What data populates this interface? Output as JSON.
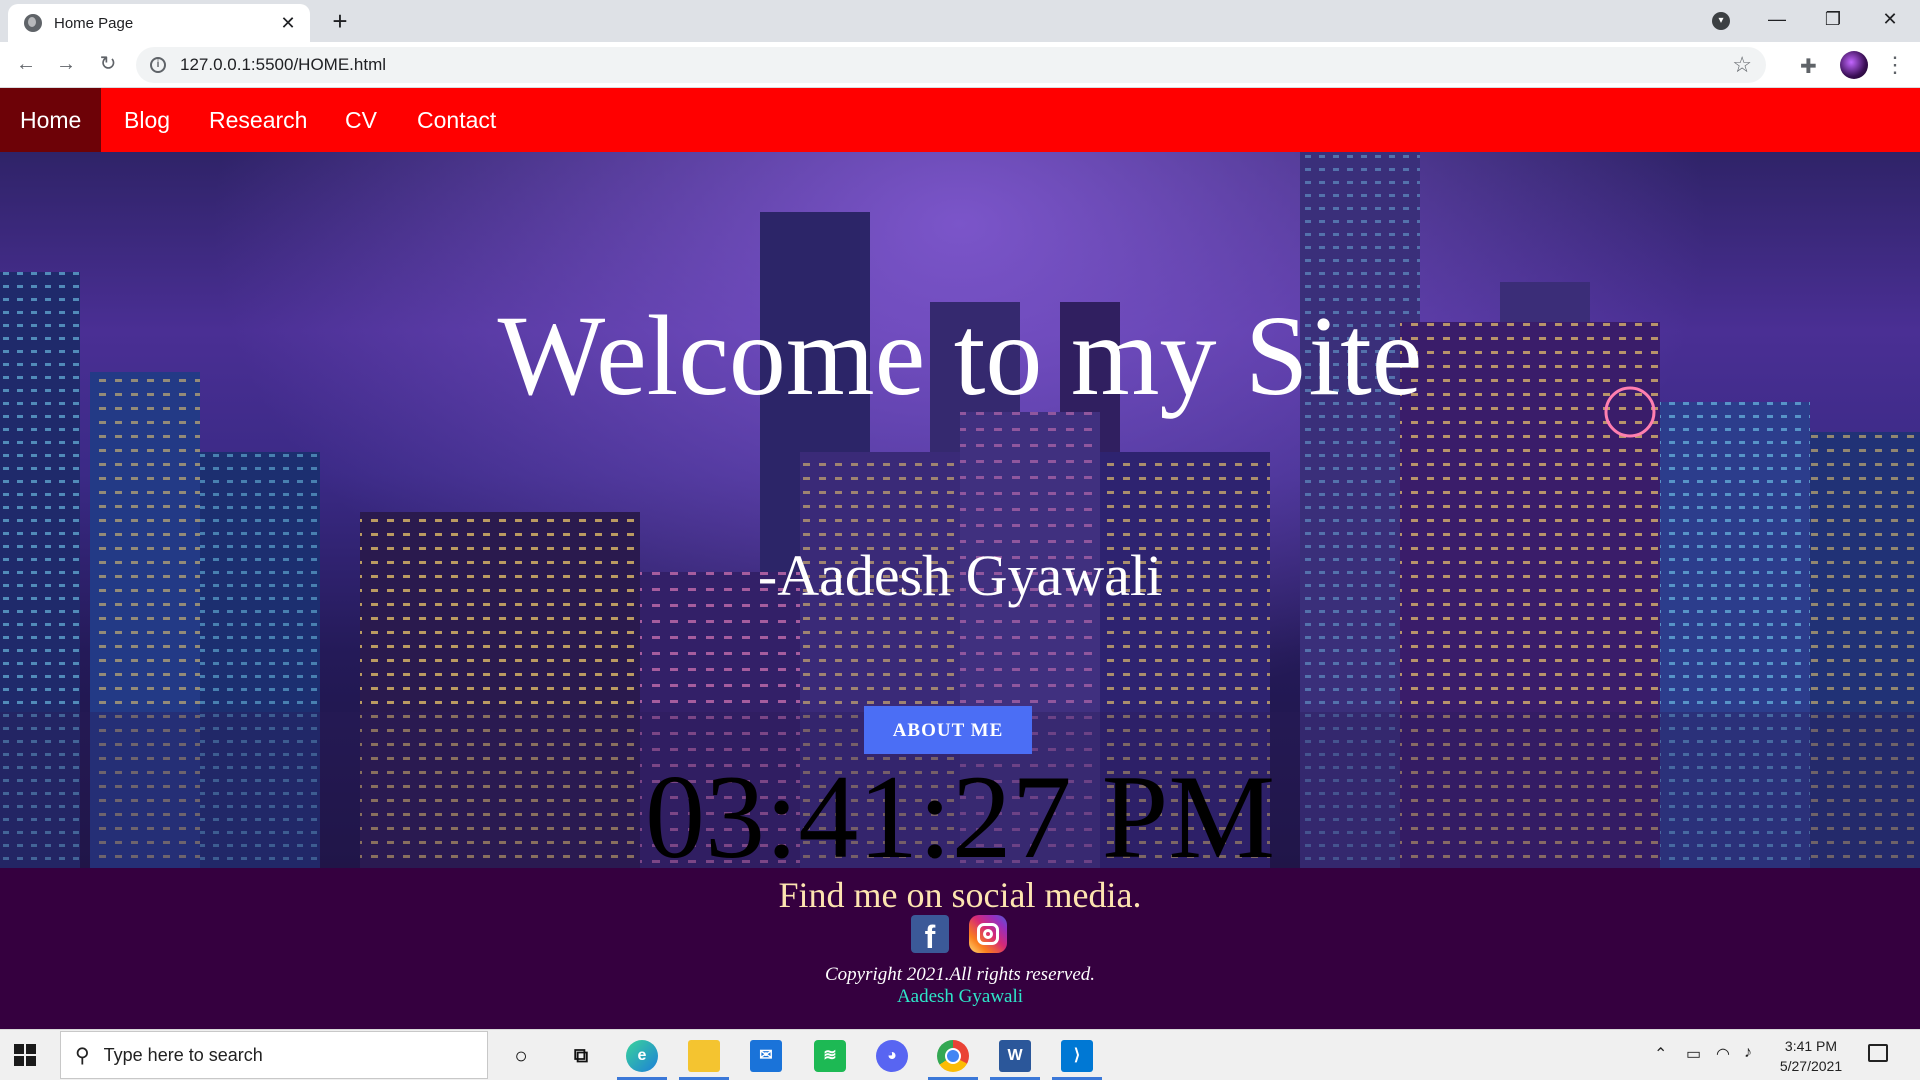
{
  "browser": {
    "tab_title": "Home Page",
    "tab_close": "✕",
    "new_tab": "+",
    "url": "127.0.0.1:5500/HOME.html",
    "minimize": "—",
    "maximize": "❐",
    "close": "✕"
  },
  "site": {
    "nav": [
      {
        "label": "Home",
        "active": true
      },
      {
        "label": "Blog"
      },
      {
        "label": "Research"
      },
      {
        "label": "CV"
      },
      {
        "label": "Contact"
      }
    ],
    "hero": {
      "title": "Welcome to my Site",
      "author": "-Aadesh Gyawali",
      "about_button": "ABOUT ME",
      "clock": "03:41:27 PM"
    },
    "footer": {
      "tagline": "Find me on social media.",
      "social": [
        {
          "name": "facebook-icon",
          "glyph": "f"
        },
        {
          "name": "instagram-icon"
        }
      ],
      "copyright": "Copyright 2021.All rights reserved.",
      "author": "Aadesh Gyawali"
    },
    "colors": {
      "nav": "#ff0000",
      "nav_active": "#6d0207",
      "footer": "#35003f",
      "button": "#4b6ef5"
    }
  },
  "taskbar": {
    "search_placeholder": "Type here to search",
    "time": "3:41 PM",
    "date": "5/27/2021",
    "apps": [
      "cortana-icon",
      "task-view-icon",
      "edge-icon",
      "file-explorer-icon",
      "mail-icon",
      "spotify-icon",
      "discord-icon",
      "chrome-icon",
      "word-icon",
      "vscode-icon"
    ]
  }
}
